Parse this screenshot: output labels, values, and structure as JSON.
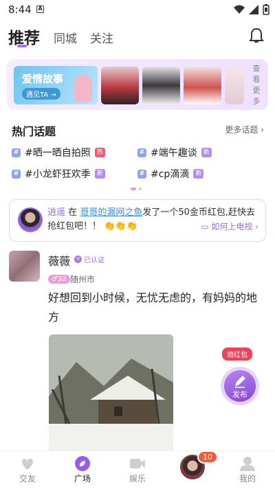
{
  "status": {
    "time": "8:44",
    "notif_icon": "A"
  },
  "tabs": [
    {
      "label": "推荐",
      "active": true
    },
    {
      "label": "同城",
      "active": false
    },
    {
      "label": "关注",
      "active": false
    }
  ],
  "banner": {
    "love_title": "爱情故事",
    "love_sub": "遇见TA →",
    "more_label": "查看更多"
  },
  "hot_topics": {
    "title": "热门话题",
    "more": "更多话题",
    "items": [
      {
        "label": "#晒一晒自拍照",
        "badge": "热",
        "badge_type": "hot"
      },
      {
        "label": "#端午趣谈",
        "badge": "新",
        "badge_type": "new"
      },
      {
        "label": "#小龙虾狂欢季",
        "badge": "新",
        "badge_type": "new"
      },
      {
        "label": "#cp滴滴",
        "badge": "新",
        "badge_type": "new"
      }
    ]
  },
  "notice": {
    "user": "逍遥",
    "in_word": "在",
    "room": "哥哥的漏网之鱼",
    "message": "发了一个50金币红包,赶快去抢红包吧！！",
    "emoji": "👏👏👏",
    "link": "如何上电视 ›"
  },
  "post": {
    "name": "薇薇",
    "verified": "已认证",
    "age": "♂32",
    "city": "随州市",
    "text": "好想回到小时候，无忧无虑的，有妈妈的地方"
  },
  "float": {
    "redpack": "领红包",
    "publish": "发布"
  },
  "bottom_nav": [
    {
      "label": "交友",
      "active": false
    },
    {
      "label": "广场",
      "active": true
    },
    {
      "label": "娱乐",
      "active": false
    },
    {
      "label": "",
      "badge": "10"
    },
    {
      "label": "我的",
      "active": false
    }
  ],
  "colors": {
    "accent": "#9a6be0",
    "hot": "#f25a6b",
    "new": "#b38cf0"
  }
}
